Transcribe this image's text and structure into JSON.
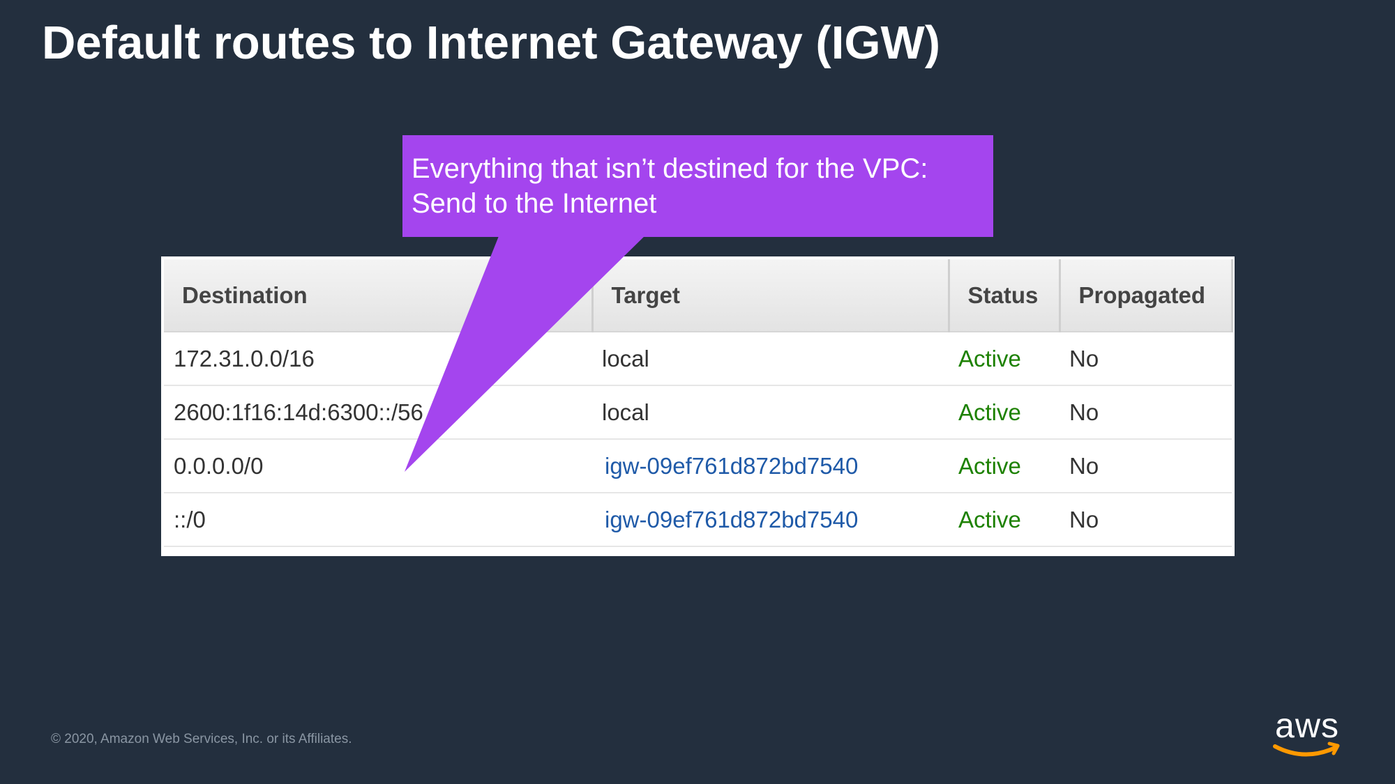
{
  "slide": {
    "title": "Default routes to Internet Gateway (IGW)",
    "background_color": "#232f3e"
  },
  "callout": {
    "line1": "Everything that isn’t destined for the VPC:",
    "line2": "Send to the Internet",
    "color": "#a445ee"
  },
  "route_table": {
    "columns": [
      "Destination",
      "Target",
      "Status",
      "Propagated"
    ],
    "rows": [
      {
        "destination": "172.31.0.0/16",
        "target": "local",
        "status": "Active",
        "propagated": "No"
      },
      {
        "destination": "2600:1f16:14d:6300::/56",
        "target": "local",
        "status": "Active",
        "propagated": "No"
      },
      {
        "destination": "0.0.0.0/0",
        "target": "igw-09ef761d872bd7540",
        "status": "Active",
        "propagated": "No"
      },
      {
        "destination": "::/0",
        "target": "igw-09ef761d872bd7540",
        "status": "Active",
        "propagated": "No"
      }
    ],
    "status_color": "#1d8102",
    "link_color": "#1f5aa8"
  },
  "footer": {
    "copyright": "© 2020, Amazon Web Services, Inc. or its Affiliates.",
    "logo_text": "aws",
    "logo_accent_color": "#ff9900"
  }
}
